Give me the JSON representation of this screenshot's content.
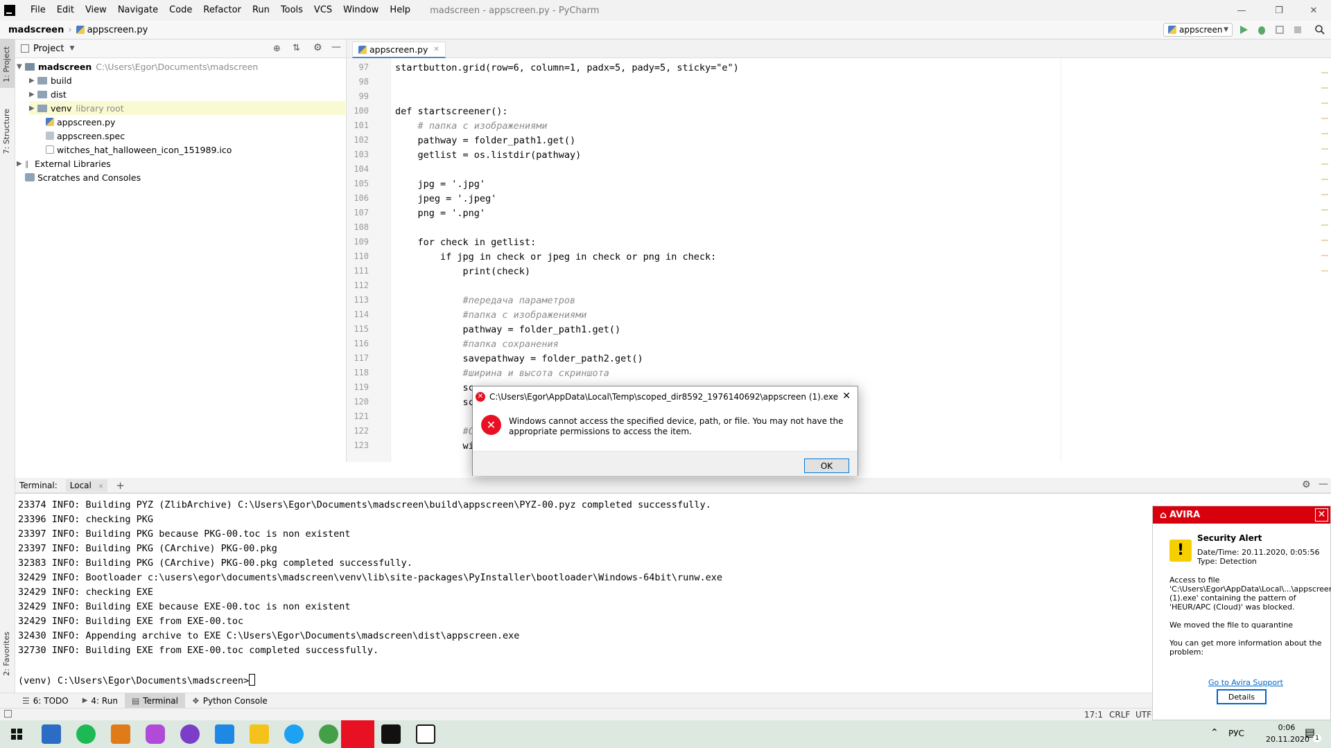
{
  "window": {
    "title": "madscreen - appscreen.py - PyCharm",
    "menu": [
      "File",
      "Edit",
      "View",
      "Navigate",
      "Code",
      "Refactor",
      "Run",
      "Tools",
      "VCS",
      "Window",
      "Help"
    ]
  },
  "navbar": {
    "project": "madscreen",
    "file": "appscreen.py",
    "run_config": "appscreen"
  },
  "left_strip": {
    "project_label": "1: Project",
    "structure_label": "7: Structure",
    "favorites_label": "2: Favorites"
  },
  "project_panel": {
    "header": "Project",
    "root_name": "madscreen",
    "root_path": "C:\\Users\\Egor\\Documents\\madscreen",
    "items": [
      {
        "name": "build"
      },
      {
        "name": "dist"
      },
      {
        "name": "venv",
        "note": "library root"
      },
      {
        "name": "appscreen.py"
      },
      {
        "name": "appscreen.spec"
      },
      {
        "name": "witches_hat_halloween_icon_151989.ico"
      },
      {
        "name": "External Libraries"
      },
      {
        "name": "Scratches and Consoles"
      }
    ]
  },
  "editor": {
    "tab_label": "appscreen.py",
    "lines": [
      {
        "n": "97",
        "code": "startbutton.grid(row=6, column=1, padx=5, pady=5, sticky=\"e\")"
      },
      {
        "n": "98",
        "code": ""
      },
      {
        "n": "99",
        "code": ""
      },
      {
        "n": "100",
        "code": "def startscreener():"
      },
      {
        "n": "101",
        "code": "    # папка с изображениями"
      },
      {
        "n": "102",
        "code": "    pathway = folder_path1.get()"
      },
      {
        "n": "103",
        "code": "    getlist = os.listdir(pathway)"
      },
      {
        "n": "104",
        "code": ""
      },
      {
        "n": "105",
        "code": "    jpg = '.jpg'"
      },
      {
        "n": "106",
        "code": "    jpeg = '.jpeg'"
      },
      {
        "n": "107",
        "code": "    png = '.png'"
      },
      {
        "n": "108",
        "code": ""
      },
      {
        "n": "109",
        "code": "    for check in getlist:"
      },
      {
        "n": "110",
        "code": "        if jpg in check or jpeg in check or png in check:"
      },
      {
        "n": "111",
        "code": "            print(check)"
      },
      {
        "n": "112",
        "code": ""
      },
      {
        "n": "113",
        "code": "            #передача параметров"
      },
      {
        "n": "114",
        "code": "            #папка с изображениями"
      },
      {
        "n": "115",
        "code": "            pathway = folder_path1.get()"
      },
      {
        "n": "116",
        "code": "            #папка сохранения"
      },
      {
        "n": "117",
        "code": "            savepathway = folder_path2.get()"
      },
      {
        "n": "118",
        "code": "            #ширина и высота скриншота"
      },
      {
        "n": "119",
        "code": "            sc"
      },
      {
        "n": "120",
        "code": "            sc"
      },
      {
        "n": "121",
        "code": ""
      },
      {
        "n": "122",
        "code": "            #C"
      },
      {
        "n": "123",
        "code": "            wi"
      }
    ]
  },
  "terminal": {
    "label": "Terminal:",
    "tab": "Local",
    "lines": [
      "23374 INFO: Building PYZ (ZlibArchive) C:\\Users\\Egor\\Documents\\madscreen\\build\\appscreen\\PYZ-00.pyz completed successfully.",
      "23396 INFO: checking PKG",
      "23397 INFO: Building PKG because PKG-00.toc is non existent",
      "23397 INFO: Building PKG (CArchive) PKG-00.pkg",
      "32383 INFO: Building PKG (CArchive) PKG-00.pkg completed successfully.",
      "32429 INFO: Bootloader c:\\users\\egor\\documents\\madscreen\\venv\\lib\\site-packages\\PyInstaller\\bootloader\\Windows-64bit\\runw.exe",
      "32429 INFO: checking EXE",
      "32429 INFO: Building EXE because EXE-00.toc is non existent",
      "32429 INFO: Building EXE from EXE-00.toc",
      "32430 INFO: Appending archive to EXE C:\\Users\\Egor\\Documents\\madscreen\\dist\\appscreen.exe",
      "32730 INFO: Building EXE from EXE-00.toc completed successfully."
    ],
    "prompt": "(venv) C:\\Users\\Egor\\Documents\\madscreen>"
  },
  "bottom_tabs": [
    {
      "label": "6: TODO"
    },
    {
      "label": "4: Run"
    },
    {
      "label": "Terminal"
    },
    {
      "label": "Python Console"
    }
  ],
  "status": {
    "position": "17:1",
    "line_ending": "CRLF",
    "encoding": "UTF-"
  },
  "dialog": {
    "title": "C:\\Users\\Egor\\AppData\\Local\\Temp\\scoped_dir8592_1976140692\\appscreen (1).exe",
    "message": "Windows cannot access the specified device, path, or file. You may not have the appropriate permissions to access the item.",
    "ok_label": "OK"
  },
  "avira": {
    "brand": "AVIRA",
    "heading": "Security Alert",
    "datetime": "Date/Time: 20.11.2020, 0:05:56",
    "type": "Type: Detection",
    "body1": "Access to file 'C:\\Users\\Egor\\AppData\\Local\\...\\appscreen (1).exe' containing the pattern of 'HEUR/APC (Cloud)' was blocked.",
    "body2": "We moved the file to quarantine",
    "body3": "You can get more information about the problem:",
    "link": "Go to Avira Support",
    "details_label": "Details"
  },
  "taskbar": {
    "lang": "РУС",
    "time": "0:06",
    "date": "20.11.2020",
    "notif_count": "1"
  },
  "colors": {
    "error_red": "#e81123",
    "avira_red": "#d9000d",
    "accent_blue": "#0078d7"
  }
}
